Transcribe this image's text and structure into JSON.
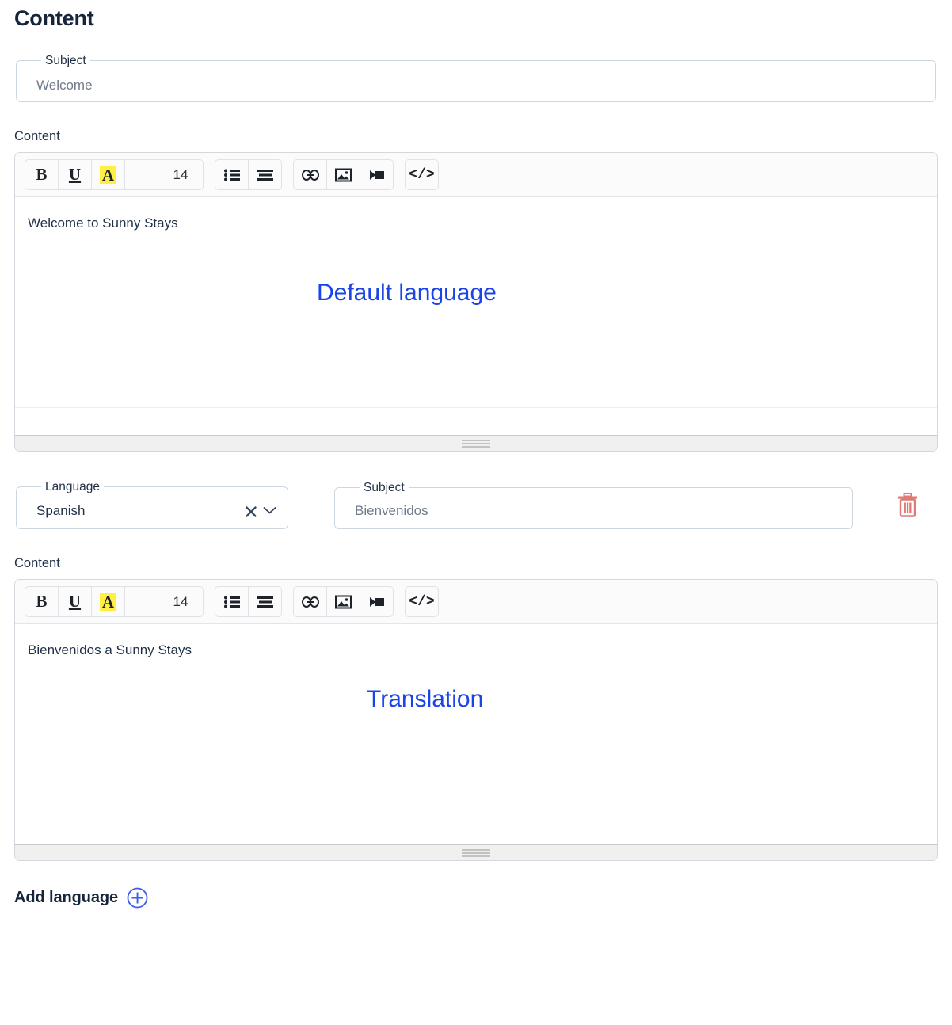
{
  "page": {
    "title": "Content"
  },
  "default_section": {
    "subject": {
      "label": "Subject",
      "value": "Welcome",
      "placeholder": "Subject"
    },
    "content_label": "Content",
    "editor": {
      "toolbar": {
        "groups": [
          {
            "buttons": [
              {
                "name": "bold-button",
                "label": "B",
                "kind": "bold"
              },
              {
                "name": "underline-button",
                "label": "U",
                "kind": "underline"
              },
              {
                "name": "font-color-button",
                "label": "A",
                "kind": "fontcolor",
                "highlight_color": "#ffef45"
              },
              {
                "name": "blank-button",
                "label": "",
                "kind": "blank"
              },
              {
                "name": "font-size-button",
                "label": "14",
                "kind": "fontsize"
              }
            ]
          },
          {
            "buttons": [
              {
                "name": "bulleted-list-button",
                "label": "",
                "kind": "list-icon"
              },
              {
                "name": "align-button",
                "label": "",
                "kind": "align-icon"
              }
            ]
          },
          {
            "buttons": [
              {
                "name": "insert-link-button",
                "label": "",
                "kind": "link-icon"
              },
              {
                "name": "insert-image-button",
                "label": "",
                "kind": "image-icon"
              },
              {
                "name": "insert-video-button",
                "label": "",
                "kind": "video-icon"
              }
            ]
          },
          {
            "buttons": [
              {
                "name": "source-code-button",
                "label": "</>",
                "kind": "code"
              }
            ]
          }
        ]
      },
      "body_text": "Welcome to Sunny Stays",
      "annotation": "Default language"
    }
  },
  "translation_section": {
    "language": {
      "label": "Language",
      "value": "Spanish",
      "clear_icon": "close-icon",
      "dropdown_icon": "chevron-down-icon"
    },
    "subject": {
      "label": "Subject",
      "value": "Bienvenidos",
      "placeholder": "Subject"
    },
    "delete_icon": "trash-icon",
    "content_label": "Content",
    "editor": {
      "body_text": "Bienvenidos a Sunny Stays",
      "annotation": "Translation"
    }
  },
  "add_language": {
    "label": "Add language",
    "icon": "plus-circle-icon"
  },
  "colors": {
    "accent_blue": "#1a44e8",
    "title_navy": "#16253c",
    "highlight_yellow": "#ffef45",
    "danger_red": "#e07a73",
    "border_gray": "#ced6de"
  }
}
